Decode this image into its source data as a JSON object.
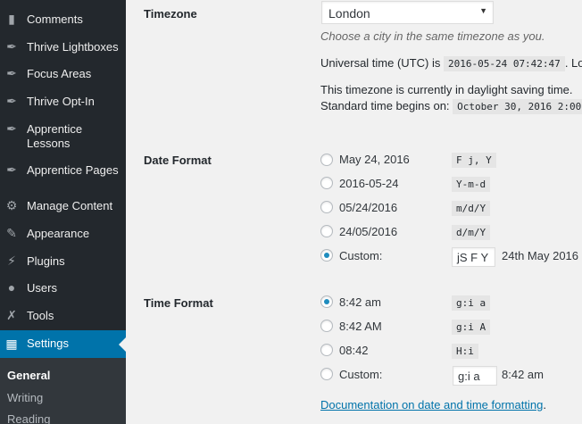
{
  "sidebar": {
    "items": [
      {
        "label": "Comments",
        "icon": "comment-bubble-icon",
        "glyph": "💬"
      },
      {
        "label": "Thrive Lightboxes",
        "icon": "pin-icon",
        "glyph": "✒"
      },
      {
        "label": "Focus Areas",
        "icon": "pin-icon",
        "glyph": "✒"
      },
      {
        "label": "Thrive Opt-In",
        "icon": "pin-icon",
        "glyph": "✒"
      },
      {
        "label": "Apprentice",
        "label2": "Lessons",
        "icon": "pin-icon",
        "glyph": "✒"
      },
      {
        "label": "Apprentice Pages",
        "icon": "pin-icon",
        "glyph": "✒"
      },
      {
        "label": "Manage Content",
        "icon": "gear-icon",
        "glyph": "⚙"
      },
      {
        "label": "Appearance",
        "icon": "paintbrush-icon",
        "glyph": "✎"
      },
      {
        "label": "Plugins",
        "icon": "plugin-icon",
        "glyph": "⚡"
      },
      {
        "label": "Users",
        "icon": "user-icon",
        "glyph": "👤"
      },
      {
        "label": "Tools",
        "icon": "wrench-icon",
        "glyph": "🔧"
      },
      {
        "label": "Settings",
        "icon": "settings-sliders-icon",
        "glyph": "▦"
      }
    ],
    "submenu": [
      "General",
      "Writing",
      "Reading"
    ]
  },
  "timezone": {
    "label": "Timezone",
    "selected": "London",
    "hint": "Choose a city in the same timezone as you.",
    "utc_prefix": "Universal time (UTC) is",
    "utc_value": "2016-05-24 07:42:47",
    "utc_suffix": ". Loc",
    "dst_line1": "This timezone is currently in daylight saving time.",
    "dst_line2": "Standard time begins on:",
    "dst_value": "October 30, 2016 2:00"
  },
  "date_format": {
    "label": "Date Format",
    "options": [
      {
        "display": "May 24, 2016",
        "code": "F j, Y",
        "checked": false
      },
      {
        "display": "2016-05-24",
        "code": "Y-m-d",
        "checked": false
      },
      {
        "display": "05/24/2016",
        "code": "m/d/Y",
        "checked": false
      },
      {
        "display": "24/05/2016",
        "code": "d/m/Y",
        "checked": false
      }
    ],
    "custom_label": "Custom:",
    "custom_value": "jS F Y",
    "custom_preview": "24th May 2016"
  },
  "time_format": {
    "label": "Time Format",
    "options": [
      {
        "display": "8:42 am",
        "code": "g:i a",
        "checked": true
      },
      {
        "display": "8:42 AM",
        "code": "g:i A",
        "checked": false
      },
      {
        "display": "08:42",
        "code": "H:i",
        "checked": false
      }
    ],
    "custom_label": "Custom:",
    "custom_value": "g:i a",
    "custom_preview": "8:42 am"
  },
  "doc_link": "Documentation on date and time formatting",
  "doc_link_suffix": "."
}
